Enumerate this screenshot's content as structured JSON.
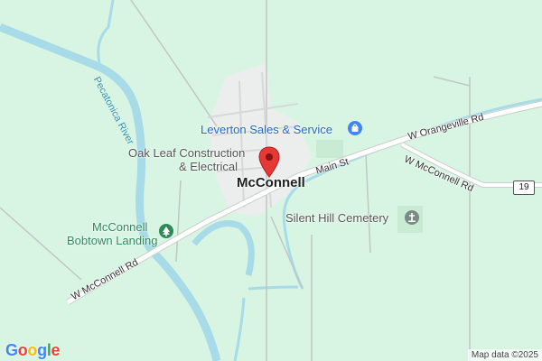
{
  "map": {
    "town_label": "McConnell",
    "roads": {
      "main_st": "Main St",
      "w_orangeville_rd": "W Orangeville Rd",
      "w_mcconnell_rd_east": "W McConnell Rd",
      "w_mcconnell_rd_west": "W McConnell Rd",
      "route_shield": "19"
    },
    "water": {
      "river": "Pecatonica River"
    },
    "places": {
      "leverton": "Leverton Sales & Service",
      "oak_leaf_line1": "Oak Leaf Construction",
      "oak_leaf_line2": "& Electrical",
      "bobtown_line1": "McConnell",
      "bobtown_line2": "Bobtown Landing",
      "cemetery": "Silent Hill Cemetery"
    },
    "icons": {
      "leverton": "shopping-bag-icon",
      "bobtown": "park-tree-icon",
      "cemetery": "cemetery-cross-icon",
      "pin": "map-pin-icon"
    },
    "colors": {
      "land": "#d8f5e3",
      "water": "#a7dbe8",
      "road": "#ffffff",
      "pin": "#e53935"
    }
  },
  "footer": {
    "logo": [
      "G",
      "o",
      "o",
      "g",
      "l",
      "e"
    ],
    "attribution": "Map data ©2025"
  }
}
